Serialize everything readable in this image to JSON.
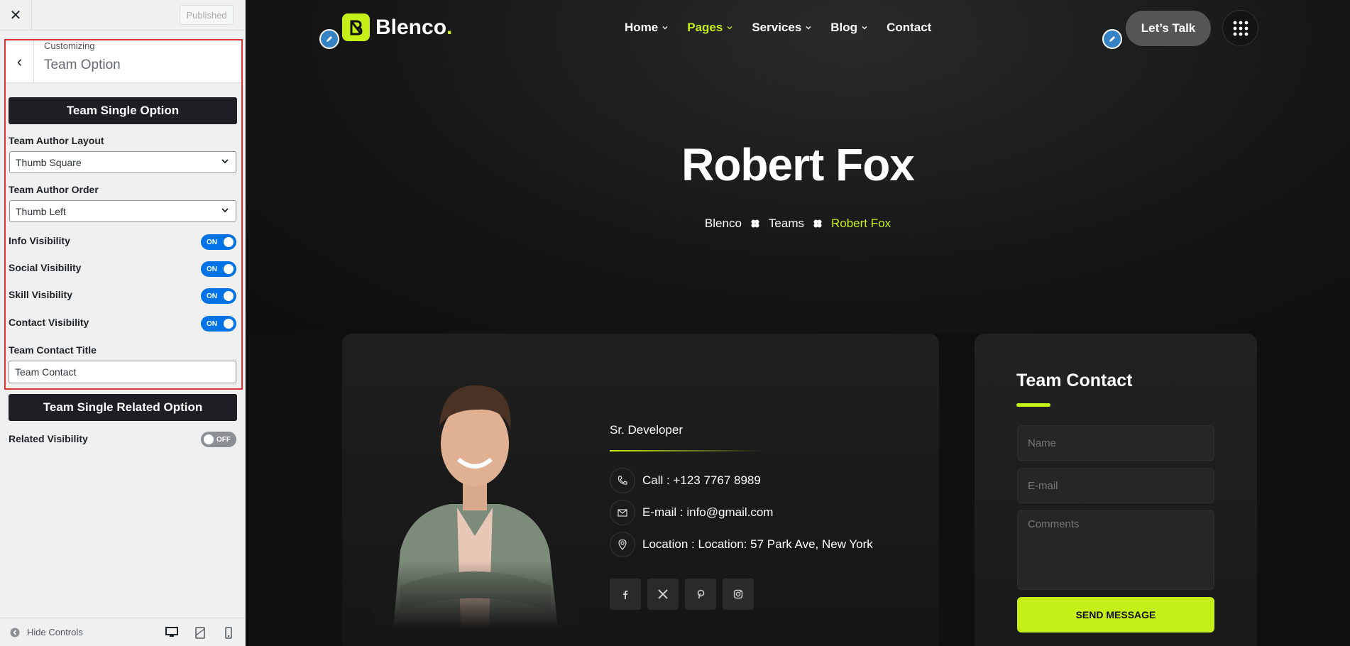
{
  "sidebar": {
    "published_label": "Published",
    "customizing_label": "Customizing",
    "section_title": "Team Option",
    "team_single_option_heading": "Team Single Option",
    "author_layout": {
      "label": "Team Author Layout",
      "value": "Thumb Square"
    },
    "author_order": {
      "label": "Team Author Order",
      "value": "Thumb Left"
    },
    "toggles": [
      {
        "label": "Info Visibility",
        "state": "ON"
      },
      {
        "label": "Social Visibility",
        "state": "ON"
      },
      {
        "label": "Skill Visibility",
        "state": "ON"
      },
      {
        "label": "Contact Visibility",
        "state": "ON"
      }
    ],
    "contact_title": {
      "label": "Team Contact Title",
      "value": "Team Contact"
    },
    "related_option_heading": "Team Single Related Option",
    "related_visibility": {
      "label": "Related Visibility",
      "state": "OFF"
    },
    "hide_controls_label": "Hide Controls"
  },
  "site": {
    "logo_text": "Blenco",
    "logo_dot": ".",
    "nav": [
      {
        "label": "Home",
        "has_dropdown": true
      },
      {
        "label": "Pages",
        "has_dropdown": true,
        "active": true
      },
      {
        "label": "Services",
        "has_dropdown": true
      },
      {
        "label": "Blog",
        "has_dropdown": true
      },
      {
        "label": "Contact",
        "has_dropdown": false
      }
    ],
    "cta_label": "Let’s Talk",
    "hero_title": "Robert Fox",
    "breadcrumb": [
      "Blenco",
      "Teams",
      "Robert Fox"
    ]
  },
  "member": {
    "role": "Sr. Developer",
    "call": "Call : +123 7767 8989",
    "email": "E-mail : info@gmail.com",
    "location": "Location : Location: 57 Park Ave, New York",
    "socials": [
      "facebook-icon",
      "x-icon",
      "pinterest-icon",
      "instagram-icon"
    ]
  },
  "contact_form": {
    "title": "Team Contact",
    "name_placeholder": "Name",
    "email_placeholder": "E-mail",
    "comments_placeholder": "Comments",
    "submit_label": "SEND MESSAGE"
  },
  "colors": {
    "accent": "#c4ef17",
    "toggle_on": "#0073e6",
    "highlight_border": "#d63638"
  }
}
